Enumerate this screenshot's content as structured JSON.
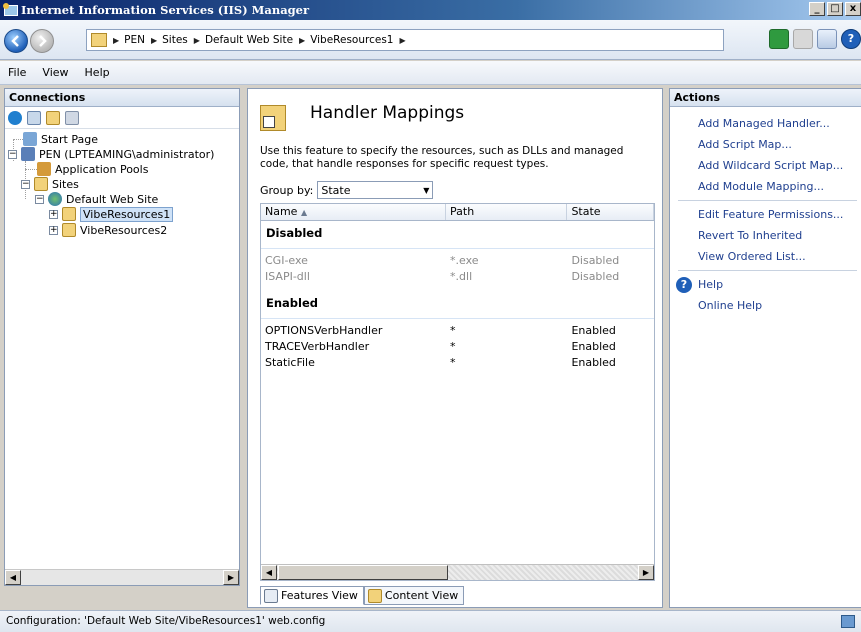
{
  "window": {
    "title": "Internet Information Services (IIS) Manager",
    "buttons": {
      "minimize": "_",
      "maximize": "□",
      "close": "x"
    }
  },
  "address": {
    "crumbs": [
      "PEN",
      "Sites",
      "Default Web Site",
      "VibeResources1"
    ],
    "separator": "▶"
  },
  "menu": {
    "file": "File",
    "view": "View",
    "help": "Help"
  },
  "connections": {
    "title": "Connections",
    "tree": {
      "start_page": "Start Page",
      "server": "PEN (LPTEAMING\\administrator)",
      "app_pools": "Application Pools",
      "sites": "Sites",
      "default_site": "Default Web Site",
      "vibe1": "VibeResources1",
      "vibe2": "VibeResources2"
    }
  },
  "center": {
    "title": "Handler Mappings",
    "description": "Use this feature to specify the resources, such as DLLs and managed code, that handle responses for specific request types.",
    "group_by_label": "Group by:",
    "group_by_value": "State",
    "columns": {
      "name": "Name",
      "sort_arrow": "▲",
      "path": "Path",
      "state": "State"
    },
    "groups": [
      {
        "label": "Disabled",
        "rows": [
          {
            "name": "CGI-exe",
            "path": "*.exe",
            "state": "Disabled"
          },
          {
            "name": "ISAPI-dll",
            "path": "*.dll",
            "state": "Disabled"
          }
        ]
      },
      {
        "label": "Enabled",
        "rows": [
          {
            "name": "OPTIONSVerbHandler",
            "path": "*",
            "state": "Enabled"
          },
          {
            "name": "TRACEVerbHandler",
            "path": "*",
            "state": "Enabled"
          },
          {
            "name": "StaticFile",
            "path": "*",
            "state": "Enabled"
          }
        ]
      }
    ],
    "tabs": {
      "features": "Features View",
      "content": "Content View"
    }
  },
  "actions": {
    "title": "Actions",
    "group1": [
      "Add Managed Handler...",
      "Add Script Map...",
      "Add Wildcard Script Map...",
      "Add Module Mapping..."
    ],
    "group2": [
      "Edit Feature Permissions...",
      "Revert To Inherited",
      "View Ordered List..."
    ],
    "help": "Help",
    "online_help": "Online Help",
    "help_icon_glyph": "?"
  },
  "status": {
    "text": "Configuration: 'Default Web Site/VibeResources1' web.config"
  },
  "colors": {
    "titlebar": "#0a246a",
    "link": "#1f3f8f",
    "selection": "#cfe2f7"
  }
}
